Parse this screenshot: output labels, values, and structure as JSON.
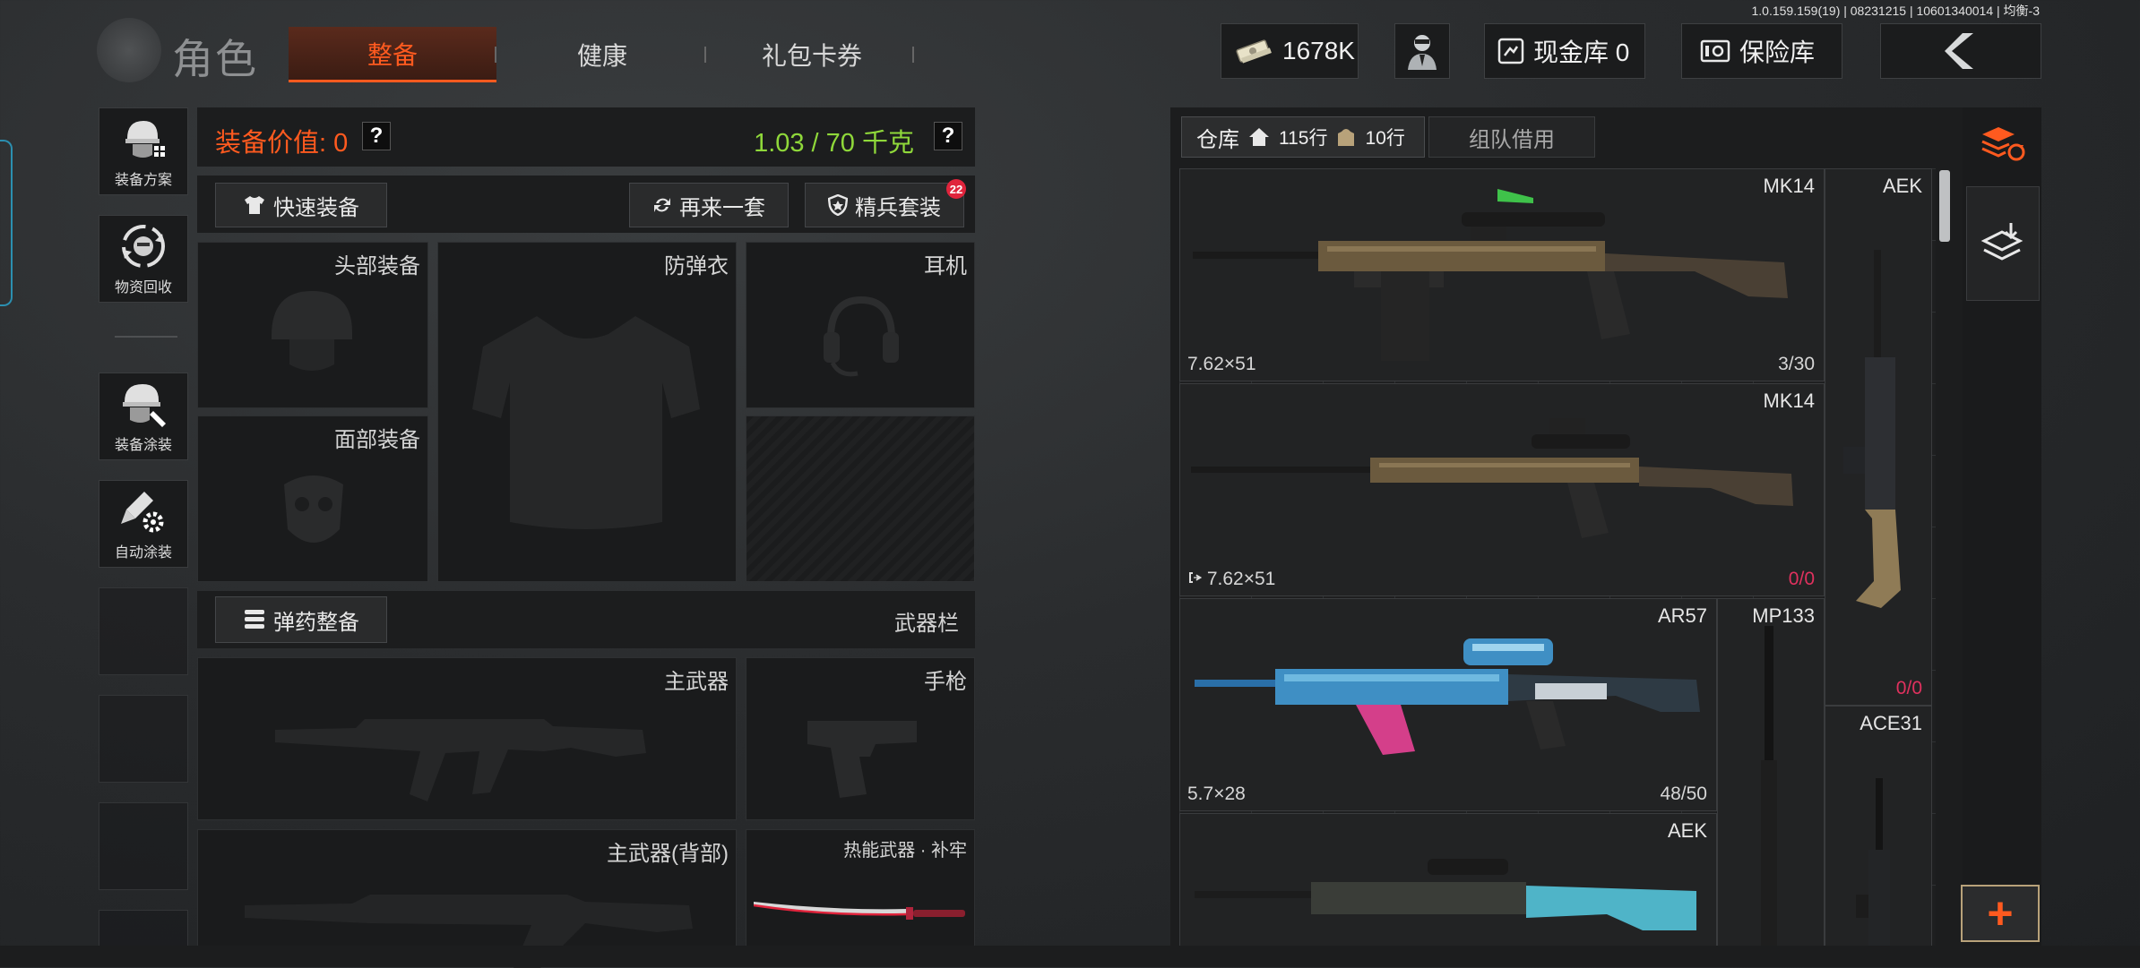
{
  "version": "1.0.159.159(19) | 08231215 | 10601340014 | 均衡-3",
  "header": {
    "title": "角色",
    "tabs": [
      {
        "label": "整备",
        "active": true
      },
      {
        "label": "健康",
        "active": false
      },
      {
        "label": "礼包卡券",
        "active": false
      }
    ],
    "money": "1678K",
    "cash_vault": "现金库 0",
    "safe_vault": "保险库"
  },
  "sidebar": {
    "items": [
      {
        "label": "装备方案",
        "icon": "soldier-helmet-grid-icon"
      },
      {
        "label": "物资回收",
        "icon": "recycle-face-icon"
      },
      {
        "label": "装备涂装",
        "icon": "helmet-paint-icon"
      },
      {
        "label": "自动涂装",
        "icon": "spray-gear-icon"
      }
    ]
  },
  "equipment": {
    "value_label": "装备价值: 0",
    "weight": "1.03 / 70 千克",
    "quick_equip": "快速装备",
    "again": "再来一套",
    "elite": "精兵套装",
    "elite_badge": "22",
    "slots": {
      "head": "头部装备",
      "vest": "防弹衣",
      "headset": "耳机",
      "face": "面部装备"
    },
    "ammo_button": "弹药整备",
    "weapon_bar": "武器栏",
    "weapons": {
      "primary": "主武器",
      "pistol": "手枪",
      "primary_back": "主武器(背部)",
      "melee": "热能武器 · 补牢"
    }
  },
  "warehouse": {
    "tab_label": "仓库",
    "home_rows": "115行",
    "bag_rows": "10行",
    "team_tab": "组队借用",
    "items": [
      {
        "name": "MK14",
        "caliber": "7.62×51",
        "ammo": "3/30"
      },
      {
        "name": "MK14",
        "caliber": "7.62×51",
        "ammo_cur": "0",
        "ammo_max": "/0"
      },
      {
        "name": "AR57",
        "caliber": "5.7×28",
        "ammo": "48/50"
      },
      {
        "name": "AEK"
      },
      {
        "name": "AEK",
        "ammo_cur": "0",
        "ammo_max": "/0"
      },
      {
        "name": "MP133"
      },
      {
        "name": "ACE31"
      }
    ]
  },
  "right_tools": {
    "add": "+"
  },
  "colors": {
    "accent": "#ff5a1f",
    "weight_green": "#8fd83a",
    "ammo_red": "#e0315e"
  }
}
